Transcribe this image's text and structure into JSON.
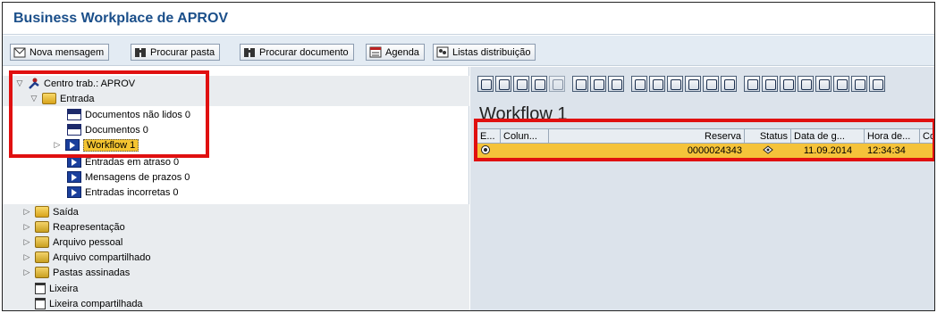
{
  "window": {
    "title": "Business Workplace de APROV"
  },
  "toolbar": {
    "buttons": [
      {
        "label": "Nova mensagem",
        "icon": "new-message-icon"
      },
      {
        "label": "Procurar pasta",
        "icon": "binoculars-icon"
      },
      {
        "label": "Procurar documento",
        "icon": "binoculars-icon"
      },
      {
        "label": "Agenda",
        "icon": "agenda-icon"
      },
      {
        "label": "Listas distribuição",
        "icon": "distribution-list-icon"
      }
    ]
  },
  "tree": {
    "root": "Centro trab.: APROV",
    "entrada": "Entrada",
    "documentos_nao_lidos": "Documentos não lidos 0",
    "documentos": "Documentos 0",
    "workflow": "Workflow 1",
    "entradas_em_atraso": "Entradas em atraso 0",
    "mensagens_de_prazos": "Mensagens de prazos 0",
    "entradas_incorretas": "Entradas incorretas 0",
    "saida": "Saída",
    "reapresentacao": "Reapresentação",
    "arquivo_pessoal": "Arquivo pessoal",
    "arquivo_compartilhado": "Arquivo compartilhado",
    "pastas_assinadas": "Pastas assinadas",
    "lixeira": "Lixeira",
    "lixeira_compartilhada": "Lixeira compartilhada"
  },
  "main": {
    "title": "Workflow 1",
    "columns": [
      "E...",
      "Colun...",
      "Reserva",
      "Status",
      "Data de g...",
      "Hora de...",
      "Colu"
    ],
    "row": {
      "reserva": "0000024343",
      "data": "11.09.2014",
      "hora": "12:34:34"
    }
  },
  "colors": {
    "title": "#1b4f8a",
    "highlight": "#e01010",
    "selected_row": "#f5c33a"
  }
}
